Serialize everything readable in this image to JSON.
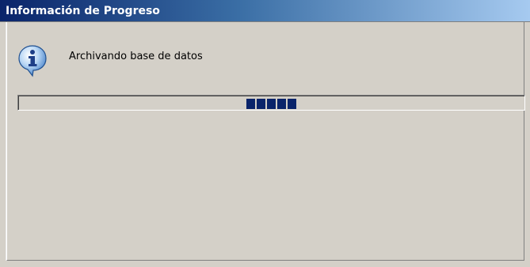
{
  "window": {
    "title": "Información de Progreso"
  },
  "message": {
    "text": "Archivando base de datos",
    "icon": "info-icon"
  },
  "progress": {
    "mode": "indeterminate-marquee",
    "block_count": 5,
    "color": "#0a246a"
  },
  "colors": {
    "titlebar_start": "#0a246a",
    "titlebar_end": "#a6caf0",
    "face": "#d4d0c8"
  }
}
